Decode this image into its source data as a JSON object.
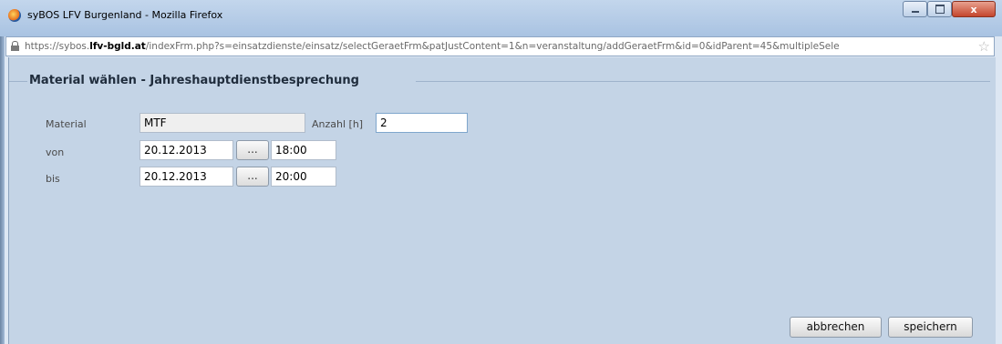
{
  "window": {
    "title": "syBOS LFV Burgenland - Mozilla Firefox",
    "close_glyph": "x"
  },
  "urlbar": {
    "prefix": "https://sybos.",
    "domain": "lfv-bgld.at",
    "path": "/indexFrm.php?s=einsatzdienste/einsatz/selectGeraetFrm&patJustContent=1&n=veranstaltung/addGeraetFrm&id=0&idParent=45&multipleSele"
  },
  "dialog": {
    "title": "Material wählen - Jahreshauptdienstbesprechung",
    "material_label": "Material",
    "material_value": "MTF",
    "anzahl_label": "Anzahl [h]",
    "anzahl_value": "2",
    "von_label": "von",
    "von_date": "20.12.2013",
    "von_time": "18:00",
    "bis_label": "bis",
    "bis_date": "20.12.2013",
    "bis_time": "20:00",
    "picker_label": "...",
    "cancel_label": "abbrechen",
    "save_label": "speichern"
  }
}
